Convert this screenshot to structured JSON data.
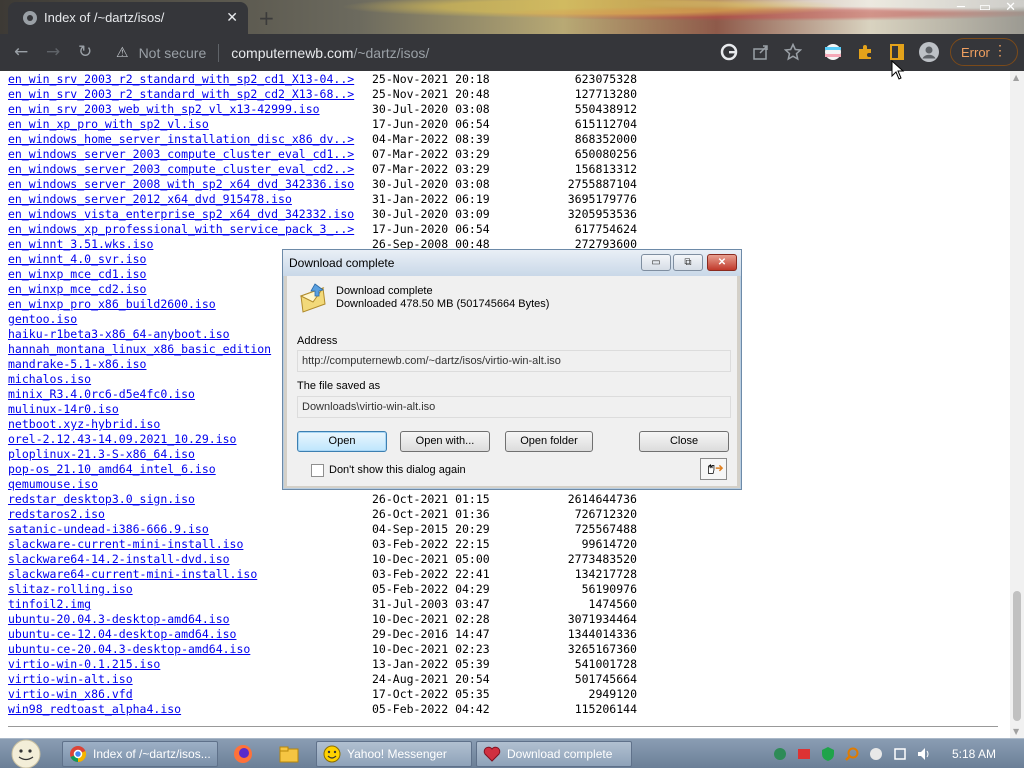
{
  "browser": {
    "tab_title": "Index of /~dartz/isos/",
    "tab_close": "✕",
    "new_tab": "+",
    "window_controls": [
      "─",
      "▭",
      "✕"
    ],
    "nav": {
      "back": "←",
      "forward": "→",
      "reload": "↻"
    },
    "security_label": "Not secure",
    "url_host": "computernewb.com",
    "url_path": "/~dartz/isos/",
    "error_label": "Error",
    "menu_glyph": "⋮"
  },
  "listing": [
    {
      "name": "en_win_srv_2003_r2_standard_with_sp2_cd1_X13-04..>",
      "date": "25-Nov-2021 20:18",
      "size": "623075328"
    },
    {
      "name": "en_win_srv_2003_r2_standard_with_sp2_cd2_X13-68..>",
      "date": "25-Nov-2021 20:48",
      "size": "127713280"
    },
    {
      "name": "en_win_srv_2003_web_with_sp2_vl_x13-42999.iso",
      "date": "30-Jul-2020 03:08",
      "size": "550438912"
    },
    {
      "name": "en_win_xp_pro_with_sp2_vl.iso",
      "date": "17-Jun-2020 06:54",
      "size": "615112704"
    },
    {
      "name": "en_windows_home_server_installation_disc_x86_dv..>",
      "date": "04-Mar-2022 08:39",
      "size": "868352000"
    },
    {
      "name": "en_windows_server_2003_compute_cluster_eval_cd1..>",
      "date": "07-Mar-2022 03:29",
      "size": "650080256"
    },
    {
      "name": "en_windows_server_2003_compute_cluster_eval_cd2..>",
      "date": "07-Mar-2022 03:29",
      "size": "156813312"
    },
    {
      "name": "en_windows_server_2008_with_sp2_x64_dvd_342336.iso",
      "date": "30-Jul-2020 03:08",
      "size": "2755887104"
    },
    {
      "name": "en_windows_server_2012_x64_dvd_915478.iso",
      "date": "31-Jan-2022 06:19",
      "size": "3695179776"
    },
    {
      "name": "en_windows_vista_enterprise_sp2_x64_dvd_342332.iso",
      "date": "30-Jul-2020 03:09",
      "size": "3205953536"
    },
    {
      "name": "en_windows_xp_professional_with_service_pack_3_..>",
      "date": "17-Jun-2020 06:54",
      "size": "617754624"
    },
    {
      "name": "en_winnt_3.51.wks.iso",
      "date": "26-Sep-2008 00:48",
      "size": "272793600"
    },
    {
      "name": "en_winnt_4.0_svr.iso",
      "date": "",
      "size": ""
    },
    {
      "name": "en_winxp_mce_cd1.iso",
      "date": "",
      "size": ""
    },
    {
      "name": "en_winxp_mce_cd2.iso",
      "date": "",
      "size": ""
    },
    {
      "name": "en_winxp_pro_x86_build2600.iso",
      "date": "",
      "size": ""
    },
    {
      "name": "gentoo.iso",
      "date": "",
      "size": ""
    },
    {
      "name": "haiku-r1beta3-x86_64-anyboot.iso",
      "date": "",
      "size": ""
    },
    {
      "name": "hannah_montana_linux_x86_basic_edition",
      "date": "",
      "size": ""
    },
    {
      "name": "mandrake-5.1-x86.iso",
      "date": "",
      "size": ""
    },
    {
      "name": "michalos.iso",
      "date": "",
      "size": ""
    },
    {
      "name": "minix_R3.4.0rc6-d5e4fc0.iso",
      "date": "",
      "size": ""
    },
    {
      "name": "mulinux-14r0.iso",
      "date": "",
      "size": ""
    },
    {
      "name": "netboot.xyz-hybrid.iso",
      "date": "",
      "size": ""
    },
    {
      "name": "orel-2.12.43-14.09.2021_10.29.iso",
      "date": "",
      "size": ""
    },
    {
      "name": "ploplinux-21.3-S-x86_64.iso",
      "date": "",
      "size": ""
    },
    {
      "name": "pop-os_21.10_amd64_intel_6.iso",
      "date": "",
      "size": ""
    },
    {
      "name": "qemumouse.iso",
      "date": "",
      "size": ""
    },
    {
      "name": "redstar_desktop3.0_sign.iso",
      "date": "26-Oct-2021 01:15",
      "size": "2614644736"
    },
    {
      "name": "redstaros2.iso",
      "date": "26-Oct-2021 01:36",
      "size": "726712320"
    },
    {
      "name": "satanic-undead-i386-666.9.iso",
      "date": "04-Sep-2015 20:29",
      "size": "725567488"
    },
    {
      "name": "slackware-current-mini-install.iso",
      "date": "03-Feb-2022 22:15",
      "size": "99614720"
    },
    {
      "name": "slackware64-14.2-install-dvd.iso",
      "date": "10-Dec-2021 05:00",
      "size": "2773483520"
    },
    {
      "name": "slackware64-current-mini-install.iso",
      "date": "03-Feb-2022 22:41",
      "size": "134217728"
    },
    {
      "name": "slitaz-rolling.iso",
      "date": "05-Feb-2022 04:29",
      "size": "56190976"
    },
    {
      "name": "tinfoil2.img",
      "date": "31-Jul-2003 03:47",
      "size": "1474560"
    },
    {
      "name": "ubuntu-20.04.3-desktop-amd64.iso",
      "date": "10-Dec-2021 02:28",
      "size": "3071934464"
    },
    {
      "name": "ubuntu-ce-12.04-desktop-amd64.iso",
      "date": "29-Dec-2016 14:47",
      "size": "1344014336"
    },
    {
      "name": "ubuntu-ce-20.04.3-desktop-amd64.iso",
      "date": "10-Dec-2021 02:23",
      "size": "3265167360"
    },
    {
      "name": "virtio-win-0.1.215.iso",
      "date": "13-Jan-2022 05:39",
      "size": "541001728"
    },
    {
      "name": "virtio-win-alt.iso",
      "date": "24-Aug-2021 20:54",
      "size": "501745664"
    },
    {
      "name": "virtio-win_x86.vfd",
      "date": "17-Oct-2022 05:35",
      "size": "2949120"
    },
    {
      "name": "win98_redtoast_alpha4.iso",
      "date": "05-Feb-2022 04:42",
      "size": "115206144"
    }
  ],
  "dialog": {
    "title": "Download complete",
    "heading": "Download complete",
    "subheading": "Downloaded 478.50  MB (501745664 Bytes)",
    "address_label": "Address",
    "address_value": "http://computernewb.com/~dartz/isos/virtio-win-alt.iso",
    "saved_label": "The file saved as",
    "saved_value": "Downloads\\virtio-win-alt.iso",
    "btn_open": "Open",
    "btn_open_with": "Open with...",
    "btn_open_folder": "Open folder",
    "btn_close": "Close",
    "checkbox_label": "Don't show this dialog again",
    "window_buttons": [
      "▭",
      "⧉",
      "✕"
    ]
  },
  "taskbar": {
    "items": [
      {
        "label": "Index of /~dartz/isos..."
      },
      {
        "label": "Yahoo! Messenger"
      },
      {
        "label": "Download complete"
      }
    ],
    "clock": "5:18 AM"
  }
}
